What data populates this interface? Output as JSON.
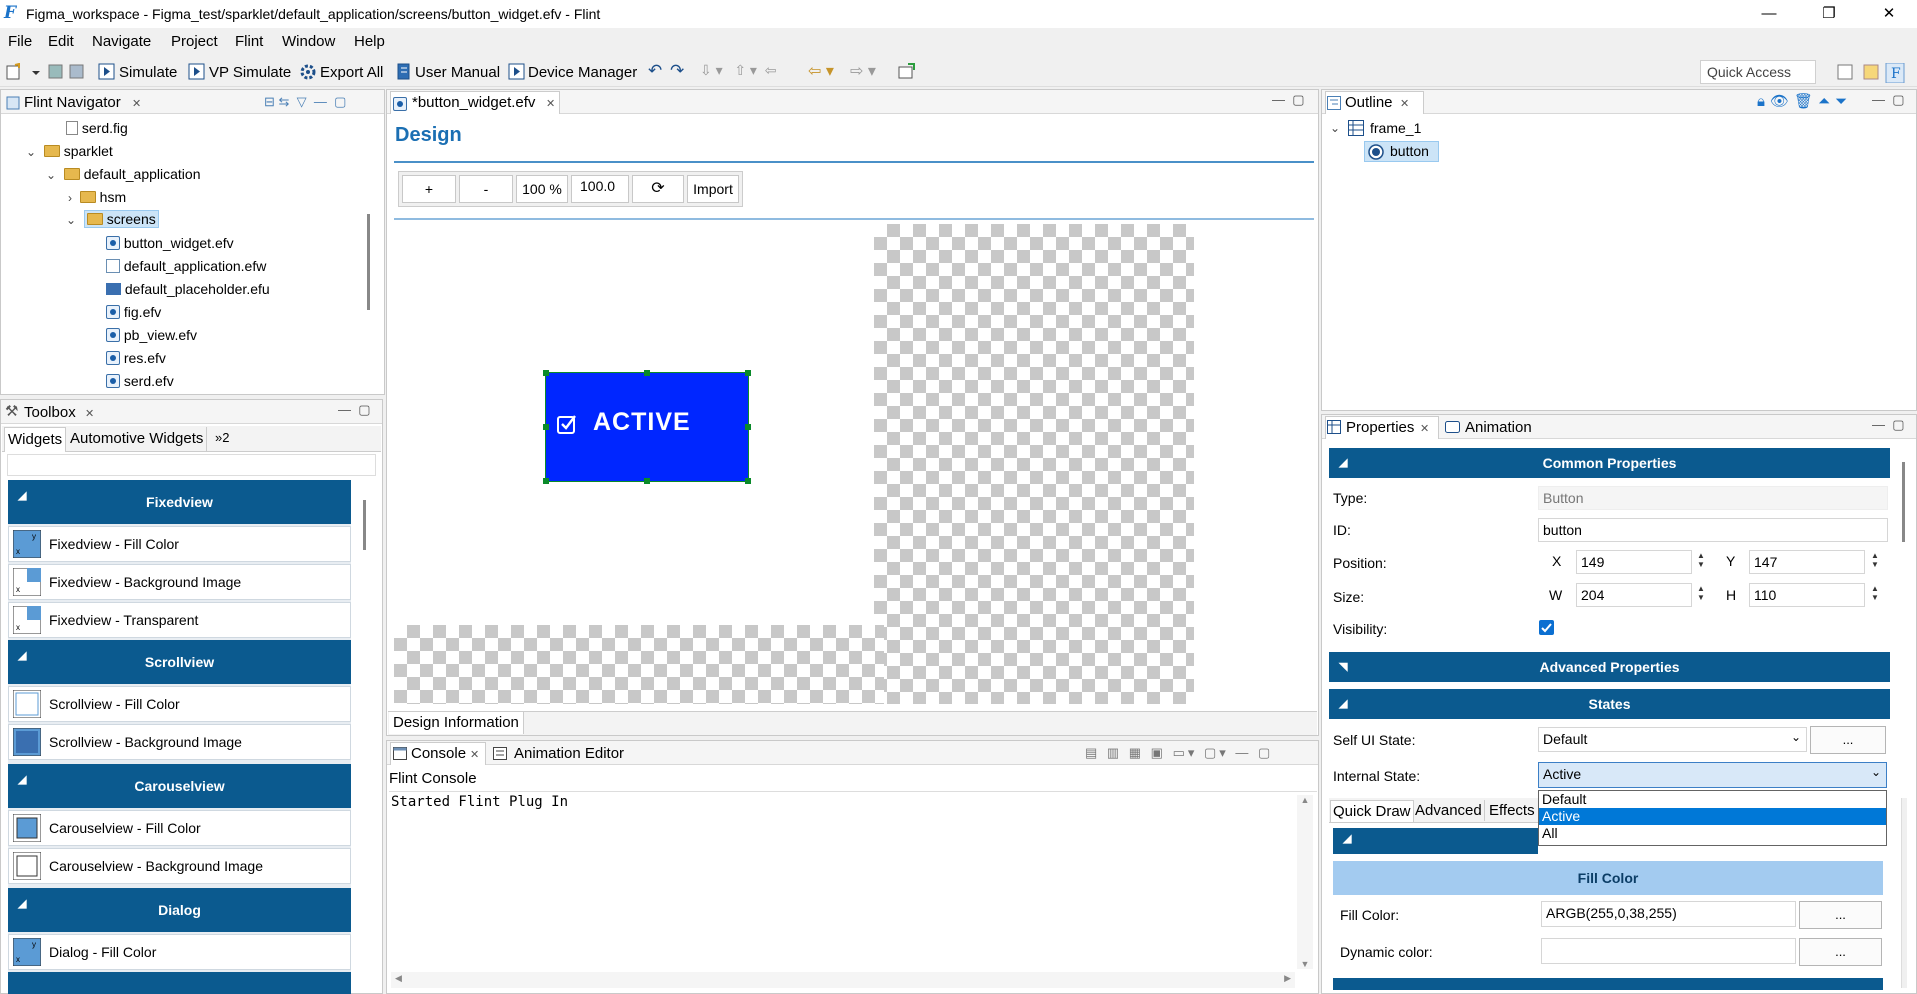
{
  "window": {
    "title": "Figma_workspace - Figma_test/sparklet/default_application/screens/button_widget.efv - Flint",
    "minimize": "—",
    "maximize": "❐",
    "close": "✕"
  },
  "menu": [
    "File",
    "Edit",
    "Navigate",
    "Project",
    "Flint",
    "Window",
    "Help"
  ],
  "toolbar": {
    "simulate": "Simulate",
    "vp_simulate": "VP Simulate",
    "export_all": "Export All",
    "user_manual": "User Manual",
    "device_manager": "Device Manager",
    "quick_access": "Quick Access"
  },
  "navigator": {
    "tab": "Flint Navigator",
    "items": [
      {
        "label": "serd.fig",
        "icon": "fig-file-icon"
      },
      {
        "label": "sparklet",
        "icon": "folder-icon"
      },
      {
        "label": "default_application",
        "icon": "folder-icon"
      },
      {
        "label": "hsm",
        "icon": "folder-icon"
      },
      {
        "label": "screens",
        "icon": "folder-icon"
      },
      {
        "label": "button_widget.efv",
        "icon": "efv-file-icon"
      },
      {
        "label": "default_application.efw",
        "icon": "efw-file-icon"
      },
      {
        "label": "default_placeholder.efu",
        "icon": "efu-file-icon"
      },
      {
        "label": "fig.efv",
        "icon": "efv-file-icon"
      },
      {
        "label": "pb_view.efv",
        "icon": "efv-file-icon"
      },
      {
        "label": "res.efv",
        "icon": "efv-file-icon"
      },
      {
        "label": "serd.efv",
        "icon": "efv-file-icon"
      }
    ]
  },
  "toolbox": {
    "tab": "Toolbox",
    "subtabs": [
      "Widgets",
      "Automotive Widgets",
      "»2"
    ],
    "sections": [
      {
        "title": "Fixedview",
        "items": [
          "Fixedview - Fill Color",
          "Fixedview - Background Image",
          "Fixedview - Transparent"
        ]
      },
      {
        "title": "Scrollview",
        "items": [
          "Scrollview - Fill Color",
          "Scrollview - Background Image"
        ]
      },
      {
        "title": "Carouselview",
        "items": [
          "Carouselview - Fill Color",
          "Carouselview - Background Image"
        ]
      },
      {
        "title": "Dialog",
        "items": [
          "Dialog - Fill Color"
        ]
      }
    ]
  },
  "editor": {
    "tab": "*button_widget.efv",
    "heading": "Design",
    "zoom_in": "+",
    "zoom_out": "-",
    "zoom_pct": "100 %",
    "zoom_value": "100.0",
    "import": "Import",
    "canvas_button_label": "ACTIVE",
    "canvas_button_color": "#0026ff",
    "bottom_tab": "Design Information"
  },
  "console": {
    "tabs": [
      "Console",
      "Animation Editor"
    ],
    "title": "Flint Console",
    "text": "Started Flint Plug In"
  },
  "outline": {
    "tab": "Outline",
    "root": "frame_1",
    "child": "button"
  },
  "properties": {
    "tabs": [
      "Properties",
      "Animation"
    ],
    "common_header": "Common Properties",
    "type_label": "Type:",
    "type_value": "Button",
    "id_label": "ID:",
    "id_value": "button",
    "position_label": "Position:",
    "x_label": "X",
    "x_value": "149",
    "y_label": "Y",
    "y_value": "147",
    "size_label": "Size:",
    "w_label": "W",
    "w_value": "204",
    "h_label": "H",
    "h_value": "110",
    "visibility_label": "Visibility:",
    "visibility_checked": true,
    "advanced_header": "Advanced Properties",
    "states_header": "States",
    "self_ui_label": "Self UI State:",
    "self_ui_value": "Default",
    "internal_label": "Internal State:",
    "internal_value": "Active",
    "dropdown_options": [
      "Default",
      "Active",
      "All"
    ],
    "dropdown_selected": "Active",
    "dots": "...",
    "subtabs": [
      "Quick Draw",
      "Advanced",
      "Effects"
    ],
    "fill_header": "Fill Color",
    "fill_color_label": "Fill Color:",
    "fill_color_value": "ARGB(255,0,38,255)",
    "dynamic_color_label": "Dynamic color:",
    "dynamic_color_value": ""
  }
}
